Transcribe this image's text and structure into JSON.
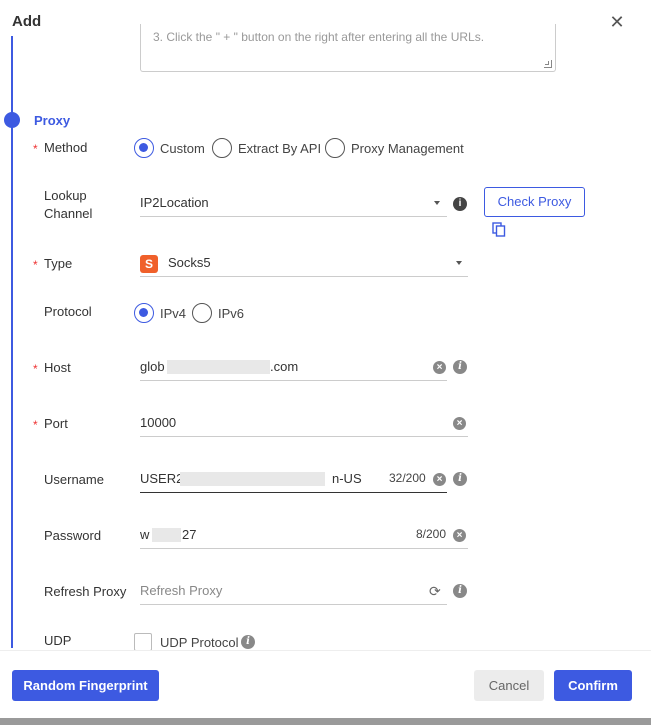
{
  "dialog": {
    "title": "Add",
    "close_glyph": "✕"
  },
  "notes": {
    "hint_line": "3. Click the \" + \" button on the right after entering all the URLs."
  },
  "section": {
    "title": "Proxy"
  },
  "method": {
    "label": "Method",
    "options": [
      "Custom",
      "Extract By API",
      "Proxy Management"
    ],
    "selected": "Custom"
  },
  "lookup": {
    "label": "Lookup Channel",
    "label_line1": "Lookup",
    "label_line2": "Channel",
    "value": "IP2Location",
    "check_button": "Check Proxy"
  },
  "type": {
    "label": "Type",
    "value": "Socks5",
    "logo_letter": "S"
  },
  "protocol": {
    "label": "Protocol",
    "options": [
      "IPv4",
      "IPv6"
    ],
    "selected": "IPv4"
  },
  "host": {
    "label": "Host",
    "value_prefix": "glob",
    "value_suffix": ".com"
  },
  "port": {
    "label": "Port",
    "value": "10000"
  },
  "username": {
    "label": "Username",
    "value_prefix": "USER2",
    "value_suffix": "n-US",
    "counter": "32/200"
  },
  "password": {
    "label": "Password",
    "value_prefix": "w",
    "value_suffix": "27",
    "counter": "8/200"
  },
  "refresh": {
    "label": "Refresh Proxy",
    "placeholder": "Refresh Proxy"
  },
  "udp": {
    "label": "UDP",
    "checkbox_label": "UDP Protocol"
  },
  "footer": {
    "random_fingerprint": "Random Fingerprint",
    "cancel": "Cancel",
    "confirm": "Confirm"
  },
  "colors": {
    "accent": "#3d5ae1",
    "required": "#ee3333",
    "socks_logo": "#f0602a"
  },
  "icons": {
    "close": "close-icon",
    "info": "info-icon",
    "clear": "clear-icon",
    "refresh": "refresh-icon",
    "copy": "copy-icon",
    "dropdown": "chevron-down-icon"
  }
}
